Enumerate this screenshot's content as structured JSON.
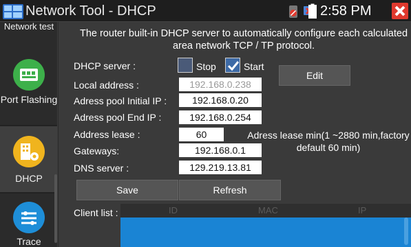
{
  "window": {
    "title": "Network Tool - DHCP",
    "time": "2:58 PM"
  },
  "sidebar": {
    "items": [
      {
        "label": "Network test"
      },
      {
        "label": "Port Flashing"
      },
      {
        "label": "DHCP"
      },
      {
        "label": "Trace"
      }
    ]
  },
  "main": {
    "description_line1": "The router built-in DHCP server to automatically configure each calculated",
    "description_line2": "area network TCP / TP protocol.",
    "dhcp_server_label": "DHCP server :",
    "stop_label": "Stop",
    "start_label": "Start",
    "edit_label": "Edit",
    "local_address_label": "Local address :",
    "local_address_value": "192.168.0.238",
    "pool_initial_label": "Adress pool Initial IP :",
    "pool_initial_value": "192.168.0.20",
    "pool_end_label": "Adress pool End IP :",
    "pool_end_value": "192.168.0.254",
    "lease_label": "Address lease :",
    "lease_value": "60",
    "lease_note_line1": "Adress lease min(1 ~2880 min,factory",
    "lease_note_line2": "default 60 min)",
    "gateways_label": "Gateways:",
    "gateways_value": "192.168.0.1",
    "dns_label": "DNS server :",
    "dns_value": "129.219.13.81",
    "save_label": "Save",
    "refresh_label": "Refresh",
    "client_list_label": "Client list :",
    "client_columns": [
      "ID",
      "MAC",
      "IP"
    ]
  }
}
